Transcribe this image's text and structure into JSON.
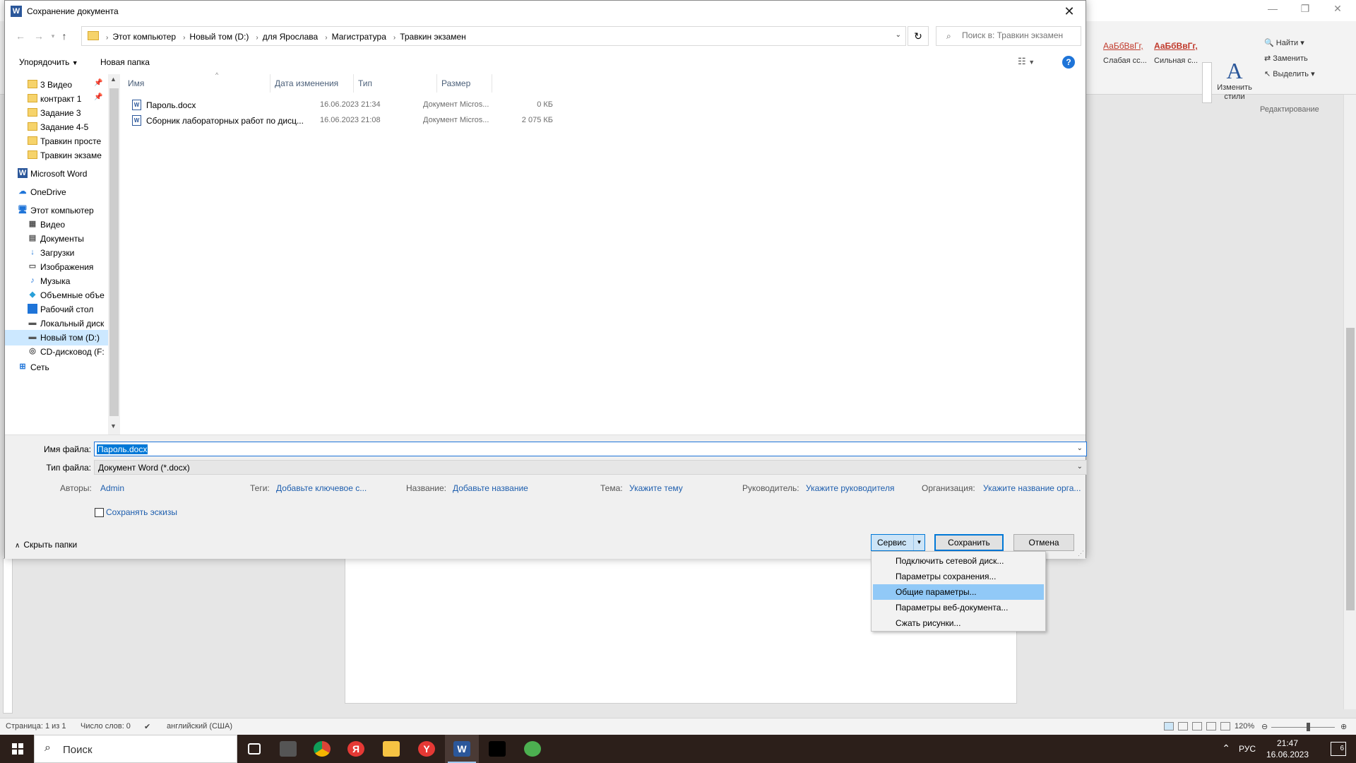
{
  "word": {
    "styles": [
      {
        "sample": "АаБбВвГг,",
        "name": "Слабая сс..."
      },
      {
        "sample": "АаБбВвГг,",
        "name": "Сильная с..."
      }
    ],
    "edit_styles_label": "Изменить стили",
    "find_label": "Найти",
    "replace_label": "Заменить",
    "select_label": "Выделить",
    "editing_group_label": "Редактирование",
    "status": {
      "page": "Страница: 1 из 1",
      "words": "Число слов: 0",
      "language": "английский (США)",
      "zoom": "120%"
    }
  },
  "dialog": {
    "title": "Сохранение документа",
    "breadcrumbs": [
      "Этот компьютер",
      "Новый том (D:)",
      "для Ярослава",
      "Магистратура",
      "Травкин экзамен"
    ],
    "search_placeholder": "Поиск в: Травкин экзамен",
    "organize_label": "Упорядочить",
    "new_folder_label": "Новая папка",
    "help_label": "?",
    "tree": [
      {
        "label": "3 Видео",
        "icon": "folder-icon",
        "pinned": true
      },
      {
        "label": "контракт 1",
        "icon": "folder-icon",
        "pinned": true
      },
      {
        "label": "Задание 3",
        "icon": "folder-icon",
        "pinned": false
      },
      {
        "label": "Задание 4-5",
        "icon": "folder-icon",
        "pinned": false
      },
      {
        "label": "Травкин просте",
        "icon": "folder-icon",
        "pinned": false
      },
      {
        "label": "Травкин экзаме",
        "icon": "folder-icon",
        "pinned": false
      },
      {
        "label": "Microsoft Word",
        "icon": "word-icon",
        "pinned": false
      },
      {
        "label": "OneDrive",
        "icon": "cloud-icon",
        "pinned": false
      },
      {
        "label": "Этот компьютер",
        "icon": "computer-icon",
        "pinned": false
      },
      {
        "label": "Видео",
        "icon": "video-icon",
        "pinned": false
      },
      {
        "label": "Документы",
        "icon": "documents-icon",
        "pinned": false
      },
      {
        "label": "Загрузки",
        "icon": "downloads-icon",
        "pinned": false
      },
      {
        "label": "Изображения",
        "icon": "pictures-icon",
        "pinned": false
      },
      {
        "label": "Музыка",
        "icon": "music-icon",
        "pinned": false
      },
      {
        "label": "Объемные объе",
        "icon": "3d-objects-icon",
        "pinned": false
      },
      {
        "label": "Рабочий стол",
        "icon": "desktop-icon",
        "pinned": false
      },
      {
        "label": "Локальный диск",
        "icon": "drive-icon",
        "pinned": false
      },
      {
        "label": "Новый том (D:)",
        "icon": "drive-icon",
        "pinned": false,
        "selected": true
      },
      {
        "label": "CD-дисковод (F:",
        "icon": "cd-drive-icon",
        "pinned": false
      },
      {
        "label": "Сеть",
        "icon": "network-icon",
        "pinned": false
      }
    ],
    "columns": [
      "Имя",
      "Дата изменения",
      "Тип",
      "Размер"
    ],
    "files": [
      {
        "name": "Пароль.docx",
        "date": "16.06.2023 21:34",
        "type": "Документ Micros...",
        "size": "0 КБ"
      },
      {
        "name": "Сборник лабораторных работ по дисц...",
        "date": "16.06.2023 21:08",
        "type": "Документ Micros...",
        "size": "2 075 КБ"
      }
    ],
    "filename_label": "Имя файла:",
    "filename_value": "Пароль.docx",
    "filetype_label": "Тип файла:",
    "filetype_value": "Документ Word (*.docx)",
    "meta": {
      "authors_label": "Авторы:",
      "authors_value": "Admin",
      "tags_label": "Теги:",
      "tags_value": "Добавьте ключевое с...",
      "title_label": "Название:",
      "title_value": "Добавьте название",
      "subject_label": "Тема:",
      "subject_value": "Укажите тему",
      "manager_label": "Руководитель:",
      "manager_value": "Укажите руководителя",
      "company_label": "Организация:",
      "company_value": "Укажите название орга..."
    },
    "save_thumbnails_label": "Сохранять эскизы",
    "hide_folders_label": "Скрыть папки",
    "service_label": "Сервис",
    "save_label": "Сохранить",
    "cancel_label": "Отмена",
    "service_menu": [
      {
        "label": "Подключить сетевой диск...",
        "highlighted": false
      },
      {
        "label": "Параметры сохранения...",
        "highlighted": false
      },
      {
        "label": "Общие параметры...",
        "highlighted": true
      },
      {
        "label": "Параметры веб-документа...",
        "highlighted": false
      },
      {
        "label": "Сжать рисунки...",
        "highlighted": false
      }
    ]
  },
  "taskbar": {
    "search_placeholder": "Поиск",
    "apps": [
      {
        "name": "task-view-icon",
        "label": "",
        "color": "#2c1f1a"
      },
      {
        "name": "app-icon-1",
        "label": "",
        "color": "#555555"
      },
      {
        "name": "chrome-icon",
        "label": "",
        "color": "#db4437"
      },
      {
        "name": "yandex-browser-icon",
        "label": "Я",
        "color": "#e53935"
      },
      {
        "name": "file-explorer-icon",
        "label": "",
        "color": "#f6c343"
      },
      {
        "name": "yandex-icon",
        "label": "Y",
        "color": "#e53935"
      },
      {
        "name": "word-icon",
        "label": "W",
        "color": "#2b579a"
      },
      {
        "name": "terminal-icon",
        "label": "",
        "color": "#000000"
      },
      {
        "name": "utorrent-icon",
        "label": "",
        "color": "#4caf50"
      },
      {
        "name": "security-icon",
        "label": "",
        "color": "#2c1f1a"
      }
    ],
    "language": "РУС",
    "time": "21:47",
    "date": "16.06.2023",
    "notifications": "6"
  }
}
